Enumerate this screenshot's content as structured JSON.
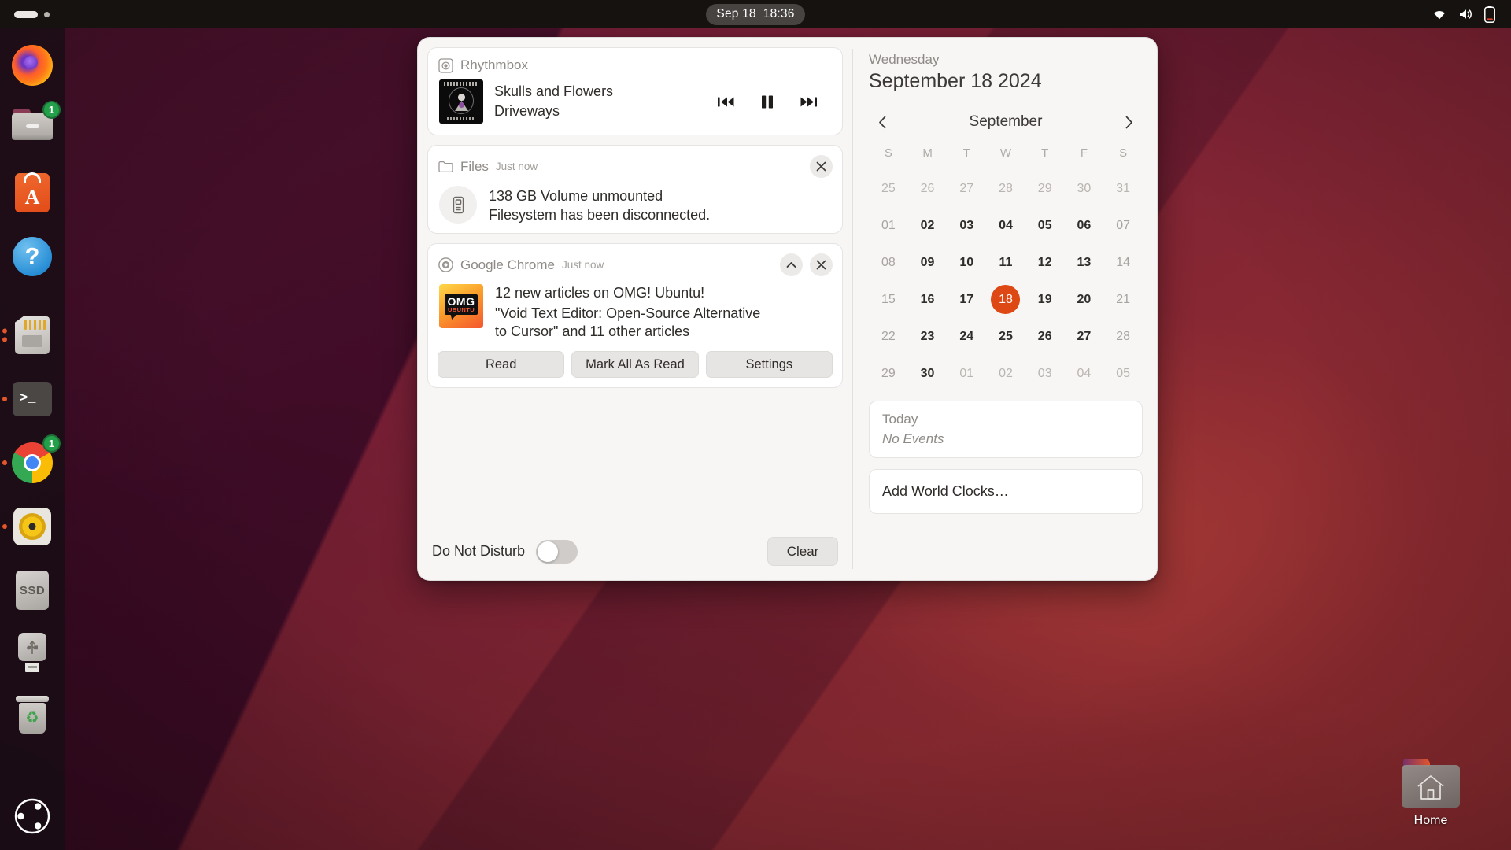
{
  "topbar": {
    "activities_label": "Activities",
    "clock": "Sep 18  18:36",
    "tray": {
      "wifi": "wifi-icon",
      "volume": "volume-icon",
      "battery": "battery-icon"
    }
  },
  "dock": {
    "items": [
      {
        "name": "firefox",
        "label": "Firefox",
        "badge": null,
        "dots": 0
      },
      {
        "name": "files",
        "label": "Files",
        "badge": "1",
        "dots": 0
      },
      {
        "name": "ubuntu-software",
        "label": "Ubuntu Software",
        "letter": "A",
        "badge": null,
        "dots": 0
      },
      {
        "name": "help",
        "label": "Help",
        "glyph": "?",
        "badge": null,
        "dots": 0
      },
      {
        "name": "sd-card",
        "label": "SD Card",
        "badge": null,
        "dots": 2
      },
      {
        "name": "terminal",
        "label": "Terminal",
        "glyph": ">_",
        "badge": null,
        "dots": 1
      },
      {
        "name": "google-chrome",
        "label": "Google Chrome",
        "badge": "1",
        "dots": 1
      },
      {
        "name": "rhythmbox",
        "label": "Rhythmbox",
        "badge": null,
        "dots": 1
      },
      {
        "name": "ssd-volume",
        "label": "SSD",
        "glyph": "SSD",
        "badge": null,
        "dots": 0
      },
      {
        "name": "usb-drive",
        "label": "USB Drive",
        "badge": null,
        "dots": 0
      },
      {
        "name": "trash",
        "label": "Trash",
        "badge": null,
        "dots": 0
      }
    ],
    "show_apps_label": "Show Applications"
  },
  "notifications": {
    "media": {
      "app_name": "Rhythmbox",
      "app_icon": "rhythmbox-icon",
      "track_title": "Skulls and Flowers",
      "track_artist": "Driveways",
      "album_art_alt": "Driveways album cover",
      "controls": {
        "previous": "previous-track-icon",
        "play_pause": "pause-icon",
        "next": "next-track-icon"
      }
    },
    "files": {
      "app_name": "Files",
      "app_icon": "folder-icon",
      "timestamp": "Just now",
      "title": "138 GB Volume unmounted",
      "body": "Filesystem has been disconnected.",
      "notification_icon": "drive-removable-icon",
      "close_label": "Close"
    },
    "chrome": {
      "app_name": "Google Chrome",
      "app_icon": "chrome-icon",
      "timestamp": "Just now",
      "title": "12 new articles on OMG! Ubuntu!",
      "body": "\"Void Text Editor: Open-Source Alternative to Cursor\" and 11 other articles",
      "source_icon": "omg-ubuntu-icon",
      "expand_label": "Collapse",
      "close_label": "Close",
      "actions": [
        {
          "name": "read",
          "label": "Read"
        },
        {
          "name": "mark-all-as-read",
          "label": "Mark All As Read"
        },
        {
          "name": "settings",
          "label": "Settings"
        }
      ]
    },
    "footer": {
      "dnd_label": "Do Not Disturb",
      "dnd_enabled": false,
      "clear_label": "Clear"
    }
  },
  "calendar": {
    "weekday": "Wednesday",
    "full_date": "September 18 2024",
    "month": "September",
    "prev_label": "Previous month",
    "next_label": "Next month",
    "day_headers": [
      "S",
      "M",
      "T",
      "W",
      "T",
      "F",
      "S"
    ],
    "weeks": [
      [
        {
          "d": "25",
          "type": "other"
        },
        {
          "d": "26",
          "type": "other"
        },
        {
          "d": "27",
          "type": "other"
        },
        {
          "d": "28",
          "type": "other"
        },
        {
          "d": "29",
          "type": "other"
        },
        {
          "d": "30",
          "type": "other"
        },
        {
          "d": "31",
          "type": "other"
        }
      ],
      [
        {
          "d": "01",
          "type": "weekend"
        },
        {
          "d": "02",
          "type": "day"
        },
        {
          "d": "03",
          "type": "day"
        },
        {
          "d": "04",
          "type": "day"
        },
        {
          "d": "05",
          "type": "day"
        },
        {
          "d": "06",
          "type": "day"
        },
        {
          "d": "07",
          "type": "weekend"
        }
      ],
      [
        {
          "d": "08",
          "type": "weekend"
        },
        {
          "d": "09",
          "type": "day"
        },
        {
          "d": "10",
          "type": "day"
        },
        {
          "d": "11",
          "type": "day"
        },
        {
          "d": "12",
          "type": "day"
        },
        {
          "d": "13",
          "type": "day"
        },
        {
          "d": "14",
          "type": "weekend"
        }
      ],
      [
        {
          "d": "15",
          "type": "weekend"
        },
        {
          "d": "16",
          "type": "day"
        },
        {
          "d": "17",
          "type": "day"
        },
        {
          "d": "18",
          "type": "today"
        },
        {
          "d": "19",
          "type": "day"
        },
        {
          "d": "20",
          "type": "day"
        },
        {
          "d": "21",
          "type": "weekend"
        }
      ],
      [
        {
          "d": "22",
          "type": "weekend"
        },
        {
          "d": "23",
          "type": "day"
        },
        {
          "d": "24",
          "type": "day"
        },
        {
          "d": "25",
          "type": "day"
        },
        {
          "d": "26",
          "type": "day"
        },
        {
          "d": "27",
          "type": "day"
        },
        {
          "d": "28",
          "type": "weekend"
        }
      ],
      [
        {
          "d": "29",
          "type": "weekend"
        },
        {
          "d": "30",
          "type": "day"
        },
        {
          "d": "01",
          "type": "other"
        },
        {
          "d": "02",
          "type": "other"
        },
        {
          "d": "03",
          "type": "other"
        },
        {
          "d": "04",
          "type": "other"
        },
        {
          "d": "05",
          "type": "other"
        }
      ]
    ],
    "events": {
      "today_label": "Today",
      "no_events_label": "No Events"
    },
    "world_clocks_label": "Add World Clocks…"
  },
  "desktop": {
    "home_icon_label": "Home"
  },
  "colors": {
    "accent": "#dd4814",
    "topbar_bg": "#16120f",
    "popover_bg": "#f7f6f5",
    "card_bg": "#ffffff",
    "badge_green": "#22a04a"
  }
}
